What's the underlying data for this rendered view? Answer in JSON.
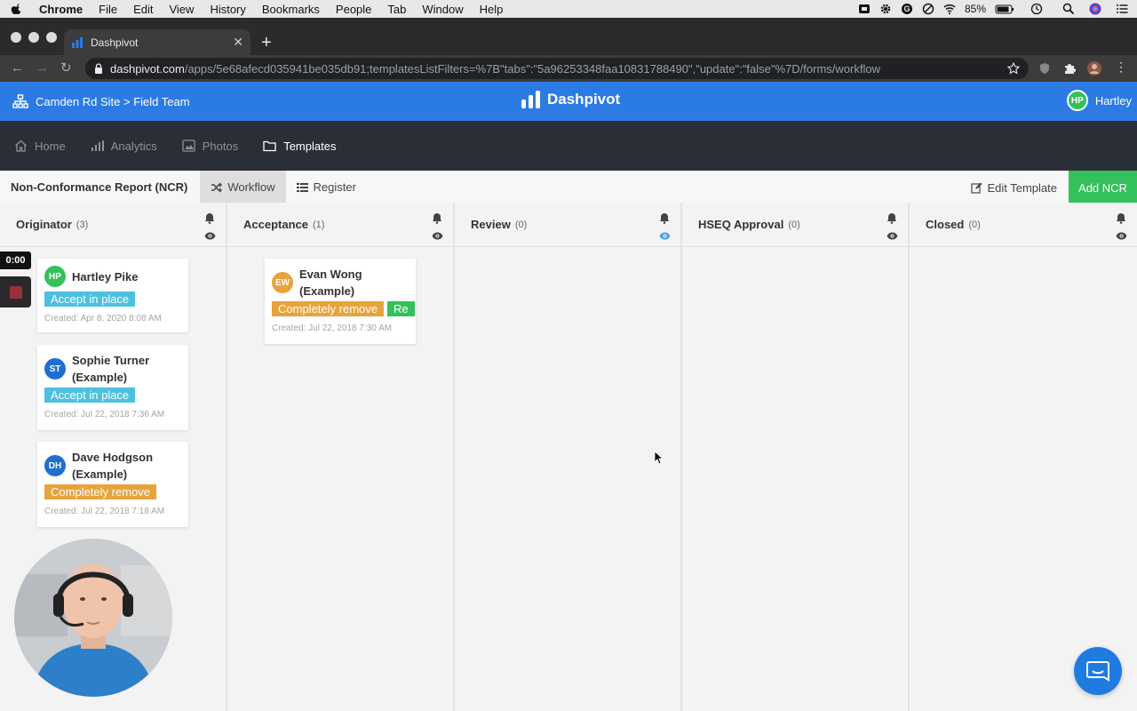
{
  "menubar": {
    "items": [
      "Chrome",
      "File",
      "Edit",
      "View",
      "History",
      "Bookmarks",
      "People",
      "Tab",
      "Window",
      "Help"
    ],
    "battery": "85%"
  },
  "browser": {
    "tab_title": "Dashpivot",
    "url_host": "dashpivot.com",
    "url_path": "/apps/5e68afecd035941be035db91;templatesListFilters=%7B\"tabs\":\"5a96253348faa10831788490\",\"update\":\"false\"%7D/forms/workflow"
  },
  "header": {
    "breadcrumb": "Camden Rd Site > Field Team",
    "brand": "Dashpivot",
    "user_initials": "HP",
    "user_name": "Hartley",
    "accent": "#2c7be5"
  },
  "nav": {
    "items": [
      {
        "label": "Home",
        "icon": "home-icon"
      },
      {
        "label": "Analytics",
        "icon": "analytics-icon"
      },
      {
        "label": "Photos",
        "icon": "photos-icon"
      },
      {
        "label": "Templates",
        "icon": "folder-icon"
      }
    ],
    "active": "Templates"
  },
  "toolbar": {
    "form_title": "Non-Conformance Report (NCR)",
    "workflow_label": "Workflow",
    "register_label": "Register",
    "edit_template_label": "Edit Template",
    "add_label": "Add NCR"
  },
  "columns": [
    {
      "name": "Originator",
      "count": "(3)"
    },
    {
      "name": "Acceptance",
      "count": "(1)"
    },
    {
      "name": "Review",
      "count": "(0)"
    },
    {
      "name": "HSEQ Approval",
      "count": "(0)"
    },
    {
      "name": "Closed",
      "count": "(0)"
    }
  ],
  "cards": {
    "c1": {
      "initials": "HP",
      "name": "Hartley Pike",
      "tag": "Accept in place",
      "created": "Created: Apr 8, 2020 8:08 AM",
      "avatar_color": "#34c05a"
    },
    "c2": {
      "initials": "ST",
      "name": "Sophie Turner (Example)",
      "tag": "Accept in place",
      "created": "Created: Jul 22, 2018 7:36 AM",
      "avatar_color": "#1f6fd1"
    },
    "c3": {
      "initials": "DH",
      "name": "Dave Hodgson (Example)",
      "tag": "Completely remove",
      "created": "Created: Jul 22, 2018 7:18 AM",
      "avatar_color": "#1f6fd1"
    },
    "c4": {
      "initials": "EW",
      "name": "Evan Wong (Example)",
      "tag": "Completely remove",
      "tag2": "Re",
      "created": "Created: Jul 22, 2018 7:30 AM",
      "avatar_color": "#e8a33d"
    }
  },
  "tag_colors": {
    "accept": "#4cc0e0",
    "remove": "#e8a33d",
    "green": "#34c05a"
  },
  "recorder": {
    "time": "0:00"
  }
}
